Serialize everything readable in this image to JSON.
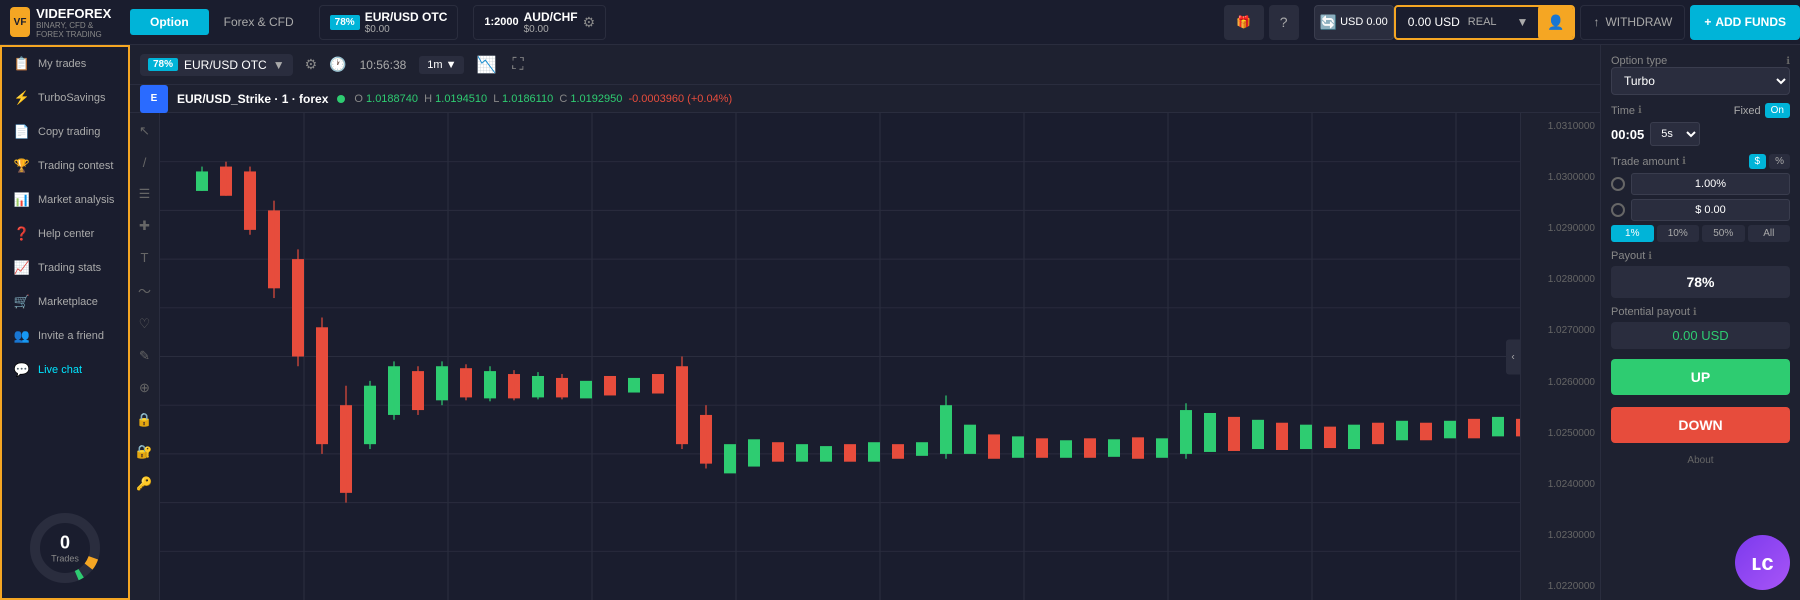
{
  "logo": {
    "icon_text": "VF",
    "main": "VIDEFOREX",
    "sub": "BINARY, CFD & FOREX TRADING"
  },
  "tabs": {
    "option_label": "Option",
    "forex_label": "Forex & CFD"
  },
  "pair1": {
    "badge": "78%",
    "name": "EUR/USD OTC",
    "price": "$0.00"
  },
  "pair2": {
    "ratio": "1:2000",
    "name": "AUD/CHF",
    "price": "$0.00"
  },
  "header": {
    "usd_amount": "USD 0.00",
    "balance": "0.00 USD",
    "balance_type": "REAL",
    "withdraw_label": "WITHDRAW",
    "add_funds_label": "ADD FUNDS"
  },
  "sidebar": {
    "items": [
      {
        "id": "my-trades",
        "label": "My trades",
        "icon": "📋"
      },
      {
        "id": "turbo-savings",
        "label": "TurboSavings",
        "icon": "⚡"
      },
      {
        "id": "copy-trading",
        "label": "Copy trading",
        "icon": "📄"
      },
      {
        "id": "trading-contest",
        "label": "Trading contest",
        "icon": "🏆"
      },
      {
        "id": "market-analysis",
        "label": "Market analysis",
        "icon": "📊"
      },
      {
        "id": "help-center",
        "label": "Help center",
        "icon": "❓"
      },
      {
        "id": "trading-stats",
        "label": "Trading stats",
        "icon": "📈"
      },
      {
        "id": "marketplace",
        "label": "Marketplace",
        "icon": "🛒"
      },
      {
        "id": "invite-friend",
        "label": "Invite a friend",
        "icon": "👥"
      },
      {
        "id": "live-chat",
        "label": "Live chat",
        "icon": "💬",
        "active": true
      }
    ],
    "donut": {
      "number": "0",
      "label": "Trades"
    }
  },
  "chart": {
    "symbol": "EUR/USD OTC",
    "badge": "78%",
    "time": "10:56:38",
    "interval": "1m",
    "full_name": "EUR/USD_Strike · 1 · forex",
    "o": "1.0188740",
    "h": "1.0194510",
    "l": "1.0186110",
    "c": "1.0192950",
    "change": "-0.0003960 (+0.04%)",
    "prices": [
      "1.0310000",
      "1.0300000",
      "1.0290000",
      "1.0280000",
      "1.0270000",
      "1.0260000",
      "1.0250000",
      "1.0240000",
      "1.0230000",
      "1.0220000"
    ]
  },
  "right_panel": {
    "option_type_label": "Option type",
    "option_type_value": "Turbo",
    "time_label": "Time",
    "time_value": "00:05",
    "fixed_label": "Fixed",
    "toggle_label": "On",
    "interval_value": "5s",
    "trade_amount_label": "Trade amount",
    "currency_dollar": "$",
    "currency_percent": "%",
    "percent_val": "1.00%",
    "dollar_val": "$ 0.00",
    "quick_btns": [
      "1%",
      "10%",
      "50%",
      "All"
    ],
    "payout_label": "Payout",
    "payout_value": "78%",
    "potential_label": "Potential payout",
    "potential_value": "0.00 USD",
    "up_label": "UP",
    "down_label": "DOWN",
    "about_label": "About"
  }
}
